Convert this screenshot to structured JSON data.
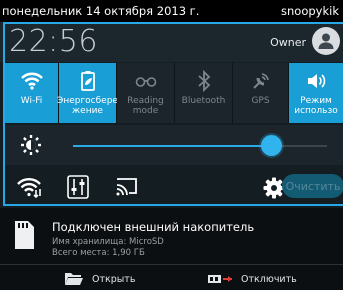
{
  "status_bar": {
    "date": "понедельник 14 октября 2013 г.",
    "user": "snoopykik"
  },
  "header": {
    "time": "22:56",
    "owner": "Owner"
  },
  "toggles": [
    {
      "label": "Wi-Fi",
      "icon": "wifi-icon",
      "state": "on"
    },
    {
      "label": "Энергосбере жение",
      "icon": "battery-saver-icon",
      "state": "on"
    },
    {
      "label": "Reading mode",
      "icon": "glasses-icon",
      "state": "off"
    },
    {
      "label": "Bluetooth",
      "icon": "bluetooth-icon",
      "state": "off"
    },
    {
      "label": "GPS",
      "icon": "gps-icon",
      "state": "off"
    },
    {
      "label": "Режим использо",
      "icon": "sound-icon",
      "state": "on"
    }
  ],
  "brightness": {
    "level": 0.78
  },
  "tools": {
    "clear_label": "Очистить"
  },
  "notification": {
    "title": "Подключен внешний накопитель",
    "line1": "Имя хранилища: MicroSD",
    "line2": "Всего места: 1,90 ГБ",
    "actions": {
      "open": "Открыть",
      "disconnect": "Отключить"
    }
  },
  "colors": {
    "accent": "#1a9ed6",
    "panel_bg": "#141d22",
    "tile_off": "#1b252b"
  }
}
